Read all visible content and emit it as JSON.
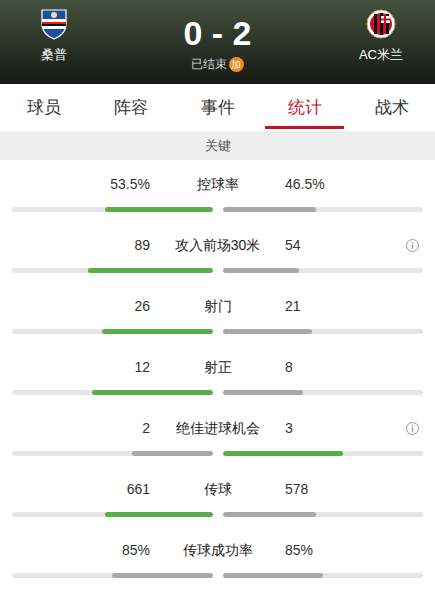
{
  "header": {
    "home": {
      "name": "桑普"
    },
    "away": {
      "name": "AC米兰"
    },
    "score": "0 - 2",
    "status": "已结束",
    "badge": "加"
  },
  "tabs": [
    {
      "label": "球员",
      "selected": false
    },
    {
      "label": "阵容",
      "selected": false
    },
    {
      "label": "事件",
      "selected": false
    },
    {
      "label": "统计",
      "selected": true
    },
    {
      "label": "战术",
      "selected": false
    }
  ],
  "section": "关键",
  "stats": [
    {
      "label": "控球率",
      "info": false,
      "home": {
        "value": "53.5%",
        "level": 0.535,
        "color": "#5aae46"
      },
      "away": {
        "value": "46.5%",
        "level": 0.465,
        "color": "#a9a9a9"
      }
    },
    {
      "label": "攻入前场30米",
      "info": true,
      "home": {
        "value": "89",
        "level": 0.62,
        "color": "#5aae46"
      },
      "away": {
        "value": "54",
        "level": 0.38,
        "color": "#a9a9a9"
      }
    },
    {
      "label": "射门",
      "info": false,
      "home": {
        "value": "26",
        "level": 0.553,
        "color": "#5aae46"
      },
      "away": {
        "value": "21",
        "level": 0.447,
        "color": "#a9a9a9"
      }
    },
    {
      "label": "射正",
      "info": false,
      "home": {
        "value": "12",
        "level": 0.6,
        "color": "#5aae46"
      },
      "away": {
        "value": "8",
        "level": 0.4,
        "color": "#a9a9a9"
      }
    },
    {
      "label": "绝佳进球机会",
      "info": true,
      "home": {
        "value": "2",
        "level": 0.4,
        "color": "#a9a9a9"
      },
      "away": {
        "value": "3",
        "level": 0.6,
        "color": "#5aae46"
      }
    },
    {
      "label": "传球",
      "info": false,
      "home": {
        "value": "661",
        "level": 0.534,
        "color": "#5aae46"
      },
      "away": {
        "value": "578",
        "level": 0.466,
        "color": "#a9a9a9"
      }
    },
    {
      "label": "传球成功率",
      "info": false,
      "home": {
        "value": "85%",
        "level": 0.5,
        "color": "#a9a9a9"
      },
      "away": {
        "value": "85%",
        "level": 0.5,
        "color": "#a9a9a9"
      }
    }
  ]
}
